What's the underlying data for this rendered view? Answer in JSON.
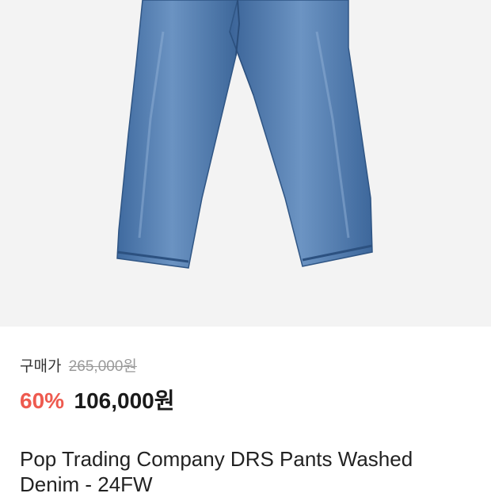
{
  "product": {
    "image_icon": "denim-pants-image",
    "purchase_label": "구매가",
    "original_price": "265,000원",
    "discount": "60%",
    "sale_price": "106,000원",
    "title": "Pop Trading Company DRS Pants Washed Denim - 24FW"
  },
  "colors": {
    "discount": "#ee5a4f",
    "image_background": "#f3f3f3",
    "denim": "#4f79ad"
  }
}
